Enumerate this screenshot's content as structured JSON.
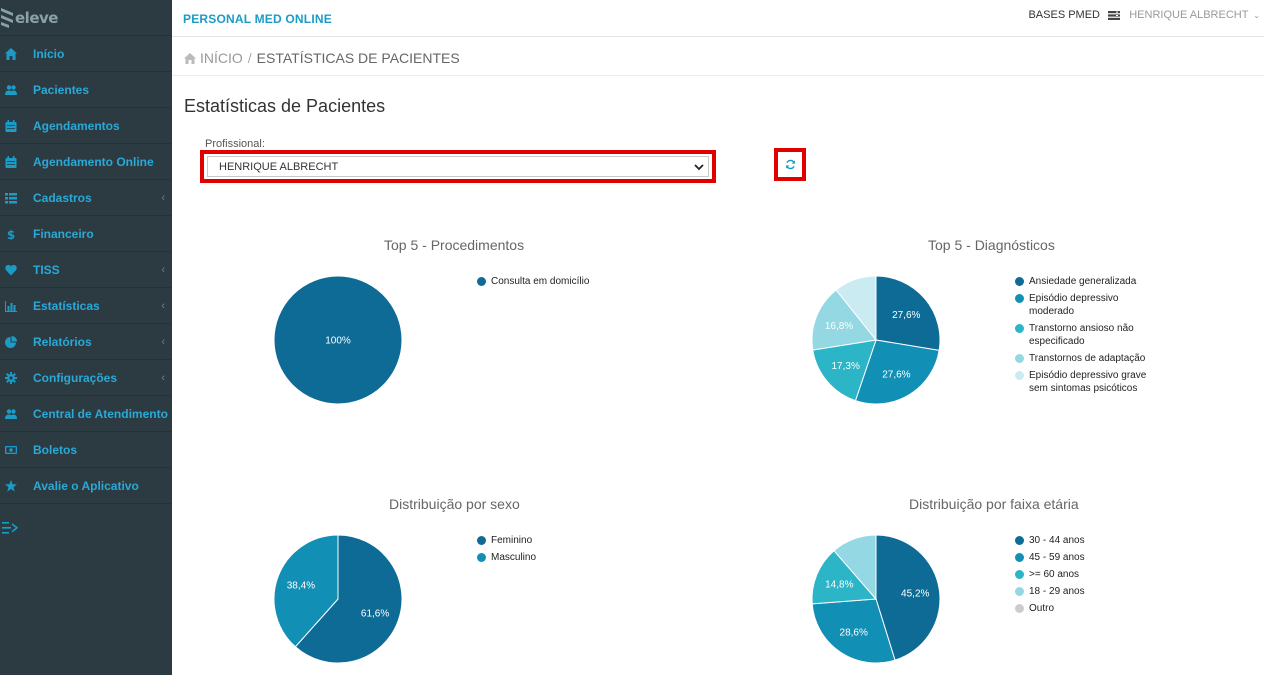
{
  "sidebar": {
    "brand": "eleve",
    "items": [
      {
        "label": "Início",
        "icon": "home-icon",
        "caret": false
      },
      {
        "label": "Pacientes",
        "icon": "users-icon",
        "caret": false
      },
      {
        "label": "Agendamentos",
        "icon": "calendar-icon",
        "caret": false
      },
      {
        "label": "Agendamento Online",
        "icon": "calendar-icon",
        "caret": false
      },
      {
        "label": "Cadastros",
        "icon": "list-icon",
        "caret": true
      },
      {
        "label": "Financeiro",
        "icon": "dollar-icon",
        "caret": false
      },
      {
        "label": "TISS",
        "icon": "heartbeat-icon",
        "caret": true
      },
      {
        "label": "Estatísticas",
        "icon": "bar-chart-icon",
        "caret": true
      },
      {
        "label": "Relatórios",
        "icon": "pie-chart-icon",
        "caret": true
      },
      {
        "label": "Configurações",
        "icon": "gear-icon",
        "caret": true
      },
      {
        "label": "Central de Atendimento",
        "icon": "users-icon",
        "caret": false
      },
      {
        "label": "Boletos",
        "icon": "money-icon",
        "caret": false
      },
      {
        "label": "Avalie o Aplicativo",
        "icon": "star-icon",
        "caret": false
      }
    ]
  },
  "header": {
    "app_title": "PERSONAL MED ONLINE",
    "bases": "BASES PMED",
    "user": "HENRIQUE ALBRECHT"
  },
  "breadcrumb": {
    "home": "INÍCIO",
    "separator": "/",
    "current": "ESTATÍSTICAS DE PACIENTES"
  },
  "page": {
    "title": "Estatísticas de Pacientes"
  },
  "filter": {
    "label": "Profissional:",
    "selected": "HENRIQUE ALBRECHT"
  },
  "chart_data": [
    {
      "type": "pie",
      "title": "Top 5 - Procedimentos",
      "categories": [
        "Consulta em domicílio"
      ],
      "values": [
        100
      ],
      "labels": [
        "100%"
      ],
      "colors": [
        "#0e6b96"
      ]
    },
    {
      "type": "pie",
      "title": "Top 5 - Diagnósticos",
      "categories": [
        "Ansiedade generalizada",
        "Episódio depressivo moderado",
        "Transtorno ansioso não especificado",
        "Transtornos de adaptação",
        "Episódio depressivo grave sem sintomas psicóticos"
      ],
      "values": [
        27.6,
        27.6,
        17.3,
        16.8,
        10.7
      ],
      "labels": [
        "27,6%",
        "27,6%",
        "17,3%",
        "16,8%",
        ""
      ],
      "colors": [
        "#0e6b96",
        "#128fb5",
        "#2bb5c6",
        "#93d8e3",
        "#c9ebf1"
      ]
    },
    {
      "type": "pie",
      "title": "Distribuição por sexo",
      "categories": [
        "Feminino",
        "Masculino"
      ],
      "values": [
        61.6,
        38.4
      ],
      "labels": [
        "61,6%",
        "38,4%"
      ],
      "colors": [
        "#0e6b96",
        "#128fb5"
      ]
    },
    {
      "type": "pie",
      "title": "Distribuição por faixa etária",
      "categories": [
        "30 - 44 anos",
        "45 - 59 anos",
        ">= 60 anos",
        "18 - 29 anos",
        "Outro"
      ],
      "values": [
        45.2,
        28.6,
        14.8,
        11.4,
        0
      ],
      "labels": [
        "45,2%",
        "28,6%",
        "14,8%",
        "",
        ""
      ],
      "colors": [
        "#0e6b96",
        "#128fb5",
        "#2bb5c6",
        "#93d8e3",
        "#cccccc"
      ]
    }
  ]
}
